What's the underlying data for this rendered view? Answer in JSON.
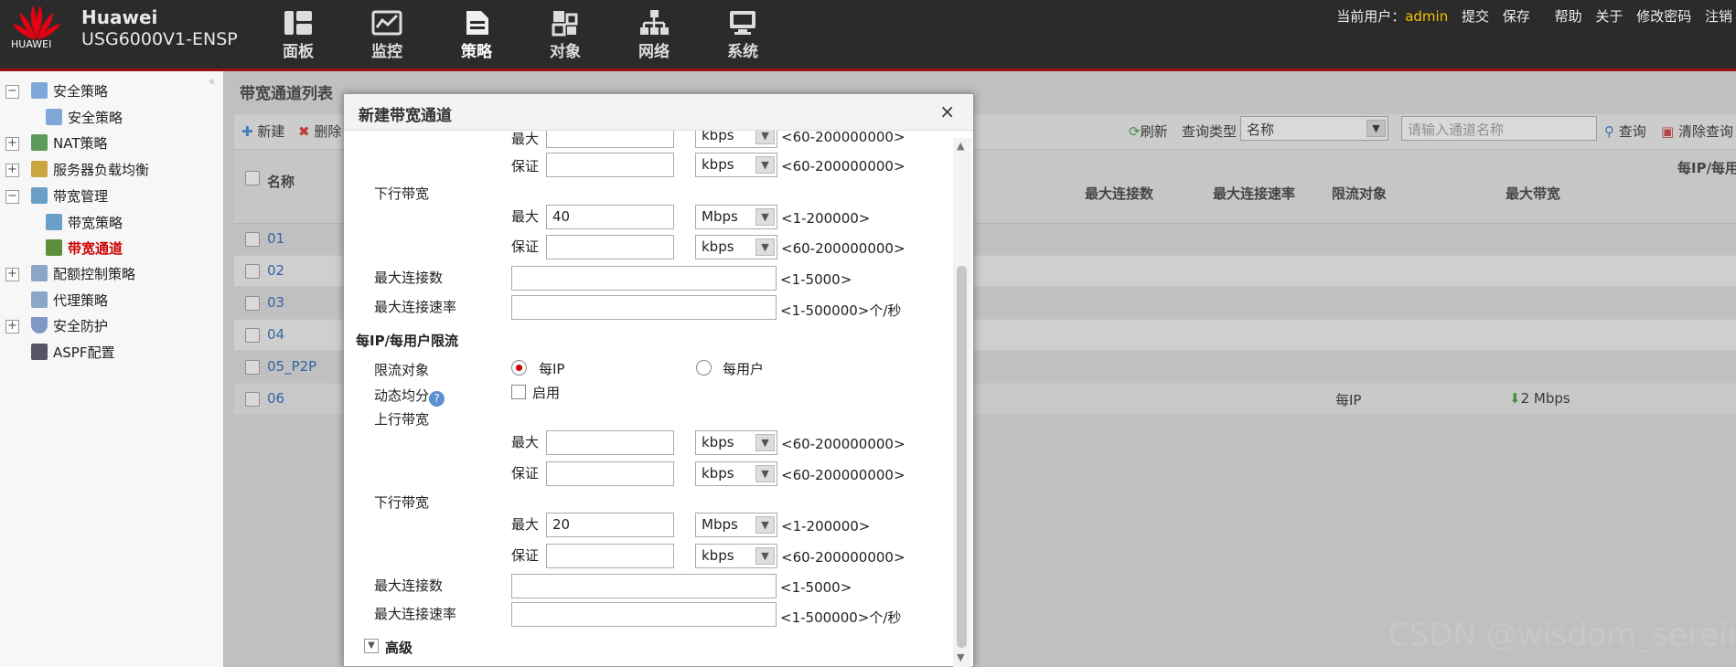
{
  "header": {
    "logo_text": "HUAWEI",
    "brand": "Huawei",
    "model": "USG6000V1-ENSP",
    "nav": [
      "面板",
      "监控",
      "策略",
      "对象",
      "网络",
      "系统"
    ],
    "current_user_label": "当前用户：",
    "current_user": "admin",
    "links": [
      "提交",
      "保存",
      "帮助",
      "关于",
      "修改密码",
      "注销"
    ]
  },
  "sidebar": {
    "items": [
      {
        "label": "安全策略",
        "level": 0,
        "expand": "−"
      },
      {
        "label": "安全策略",
        "level": 1
      },
      {
        "label": "NAT策略",
        "level": 0,
        "expand": "+"
      },
      {
        "label": "服务器负载均衡",
        "level": 0,
        "expand": "+"
      },
      {
        "label": "带宽管理",
        "level": 0,
        "expand": "−"
      },
      {
        "label": "带宽策略",
        "level": 1
      },
      {
        "label": "带宽通道",
        "level": 1,
        "active": true
      },
      {
        "label": "配额控制策略",
        "level": 0,
        "expand": "+"
      },
      {
        "label": "代理策略",
        "level": 0
      },
      {
        "label": "安全防护",
        "level": 0,
        "expand": "+"
      },
      {
        "label": "ASPF配置",
        "level": 0
      }
    ]
  },
  "list": {
    "title": "带宽通道列表",
    "new_label": "新建",
    "delete_label": "删除",
    "refresh_label": "刷新",
    "query_type_label": "查询类型",
    "query_type_value": "名称",
    "search_placeholder": "请输入通道名称",
    "query_label": "查询",
    "clear_label": "清除查询",
    "group_header": "每IP/每用",
    "columns": {
      "name": "名称",
      "max_conn": "最大连接数",
      "max_conn_rate": "最大连接速率",
      "limit_target": "限流对象",
      "max_bw": "最大带宽"
    },
    "rows": [
      {
        "name": "01",
        "target": "",
        "bw": ""
      },
      {
        "name": "02",
        "target": "",
        "bw": ""
      },
      {
        "name": "03",
        "target": "",
        "bw": ""
      },
      {
        "name": "04",
        "target": "",
        "bw": ""
      },
      {
        "name": "05_P2P",
        "target": "",
        "bw": ""
      },
      {
        "name": "06",
        "target": "每IP",
        "bw": "2 Mbps"
      }
    ]
  },
  "dialog": {
    "title": "新建带宽通道",
    "close": "×",
    "label_max": "最大",
    "label_guarantee": "保证",
    "label_down": "下行带宽",
    "label_up": "上行带宽",
    "label_max_conn": "最大连接数",
    "label_max_conn_rate": "最大连接速率",
    "section_per_ip": "每IP/每用户限流",
    "label_limit_target": "限流对象",
    "radio_per_ip": "每IP",
    "radio_per_user": "每用户",
    "label_dynamic": "动态均分",
    "enable": "启用",
    "advanced": "高级",
    "unit_kbps": "kbps",
    "unit_mbps": "Mbps",
    "hint_kbps": "<60-200000000>",
    "hint_mbps": "<1-200000>",
    "hint_conn": "<1-5000>",
    "hint_rate": "<1-500000>个/秒",
    "down1_max": "40",
    "down2_max": "20"
  },
  "watermark": "CSDN @wisdom_serein"
}
